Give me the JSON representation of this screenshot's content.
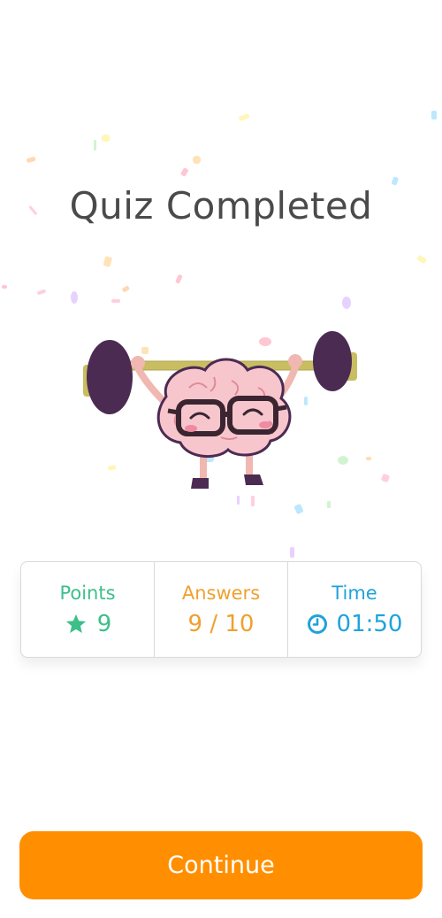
{
  "header": {
    "title": "Quiz Completed"
  },
  "stats": {
    "points": {
      "label": "Points",
      "value": "9",
      "color": "#3dbf8a",
      "icon": "star-icon"
    },
    "answers": {
      "label": "Answers",
      "value": "9 / 10",
      "color": "#f0a030"
    },
    "time": {
      "label": "Time",
      "value": "01:50",
      "color": "#1fa3dc",
      "icon": "clock-icon"
    }
  },
  "footer": {
    "continue_label": "Continue",
    "accent": "#ff8f00"
  },
  "illustration": {
    "icon": "weightlifting-brain-icon"
  }
}
